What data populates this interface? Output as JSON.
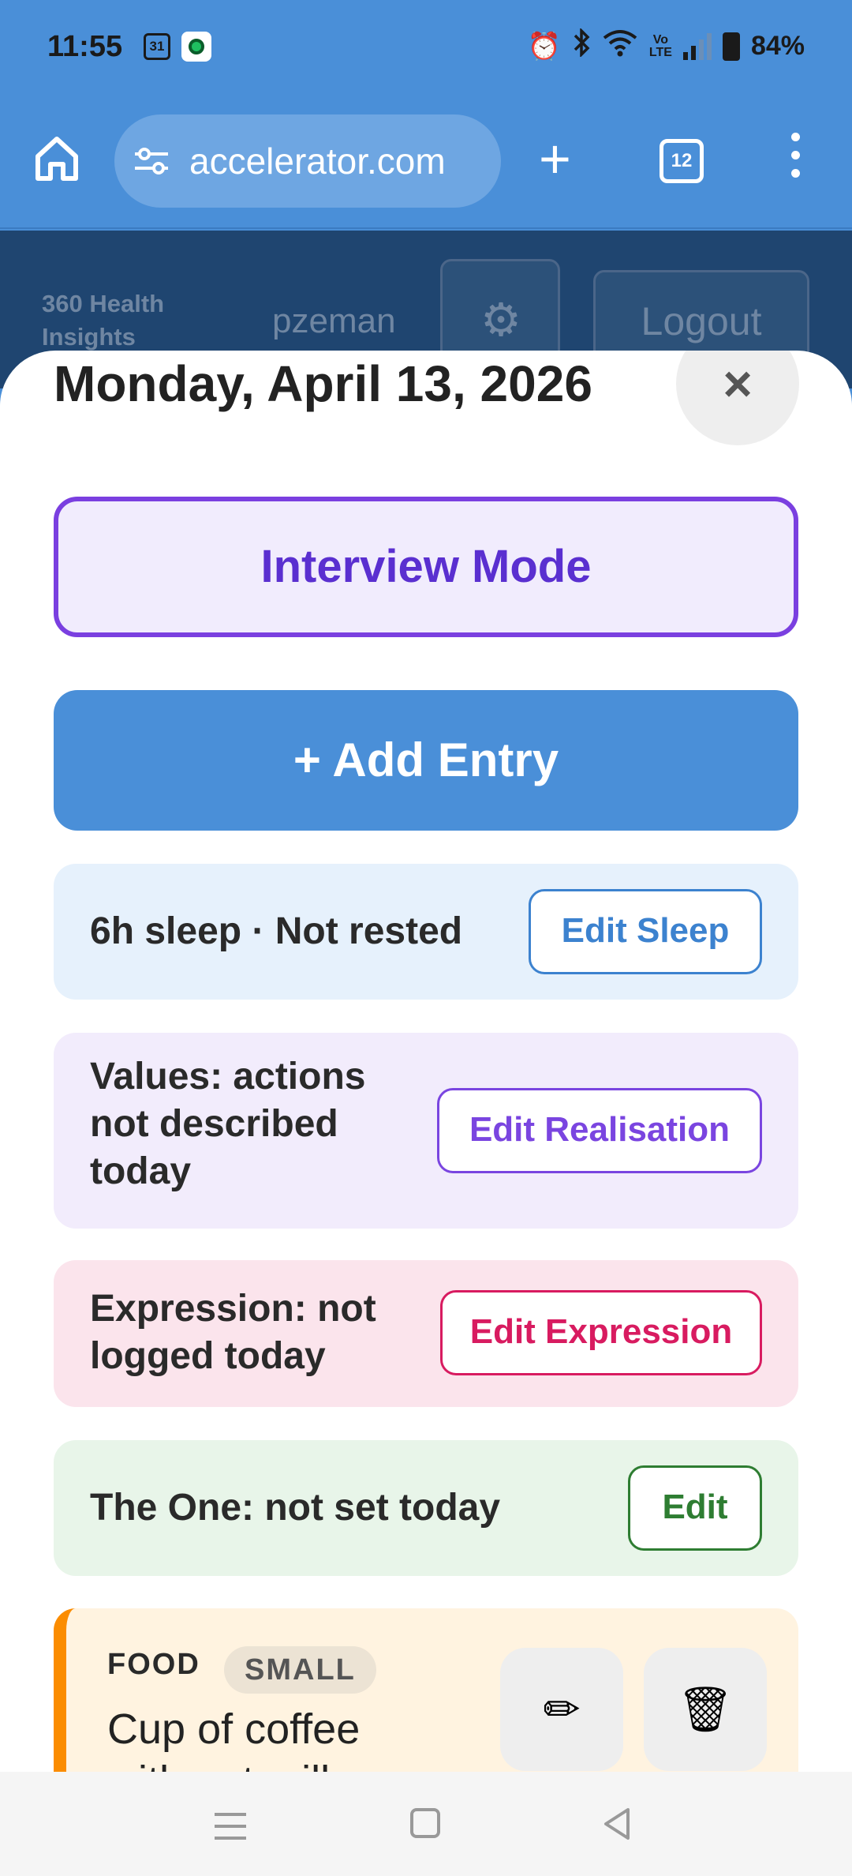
{
  "status_bar": {
    "time": "11:55",
    "calendar_day": "31",
    "volte": "Vo\nLTE",
    "battery": "84%"
  },
  "browser": {
    "url": "accelerator.com",
    "tab_count": "12"
  },
  "site_header": {
    "brand": "360 Health Insights",
    "username": "pzeman",
    "logout_label": "Logout"
  },
  "modal": {
    "date_title": "Monday, April 13, 2026",
    "close_label": "×",
    "interview_label": "Interview Mode",
    "add_entry_label": "+ Add Entry",
    "sleep": {
      "text": "6h sleep · Not rested",
      "button": "Edit Sleep"
    },
    "values": {
      "text": "Values: actions not described today",
      "button": "Edit Realisation"
    },
    "expression": {
      "text": "Expression: not logged today",
      "button": "Edit Expression"
    },
    "the_one": {
      "text": "The One: not set today",
      "button": "Edit"
    },
    "entries": [
      {
        "category": "FOOD",
        "size": "SMALL",
        "description": "Cup of coffee with oat milk",
        "edit_icon": "✏",
        "delete_icon": "🗑"
      }
    ]
  },
  "colors": {
    "brand_blue": "#4a8fd8",
    "interview_purple": "#7a3fe0",
    "expression_pink": "#d81b60",
    "one_green": "#2e7d32",
    "food_orange": "#fb8c00"
  }
}
